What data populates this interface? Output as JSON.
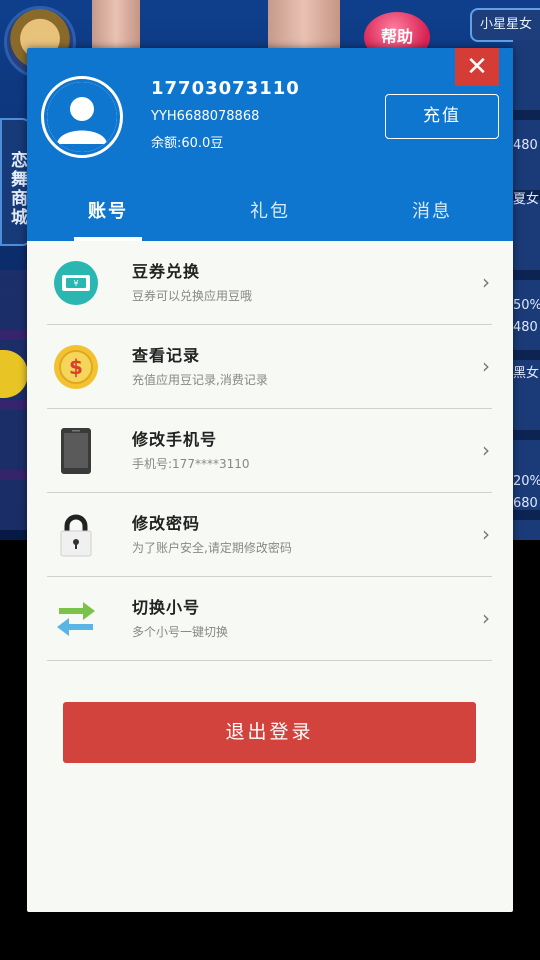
{
  "background": {
    "help_label": "帮助",
    "top_right_tag": "小星星女",
    "left_side_label": "恋舞商城",
    "right_labels": [
      "480",
      "夏女",
      "50%",
      "480",
      "黑女",
      "20%",
      "680"
    ]
  },
  "header": {
    "close_label": "✕",
    "username": "17703073110",
    "user_id": "YYH6688078868",
    "balance": "余额:60.0豆",
    "recharge_label": "充值"
  },
  "tabs": [
    {
      "label": "账号",
      "active": true
    },
    {
      "label": "礼包",
      "active": false
    },
    {
      "label": "消息",
      "active": false
    }
  ],
  "rows": [
    {
      "icon": "coupon-icon",
      "title": "豆券兑换",
      "subtitle": "豆券可以兑换应用豆哦"
    },
    {
      "icon": "coin-icon",
      "title": "查看记录",
      "subtitle": "充值应用豆记录,消费记录"
    },
    {
      "icon": "phone-icon",
      "title": "修改手机号",
      "subtitle": "手机号:177****3110"
    },
    {
      "icon": "lock-icon",
      "title": "修改密码",
      "subtitle": "为了账户安全,请定期修改密码"
    },
    {
      "icon": "swap-icon",
      "title": "切换小号",
      "subtitle": "多个小号一键切换"
    }
  ],
  "chevron": "›",
  "logout_label": "退出登录",
  "colors": {
    "header_blue": "#0f76cf",
    "danger_red": "#d3433e",
    "panel_bg": "#f6f9f4"
  }
}
